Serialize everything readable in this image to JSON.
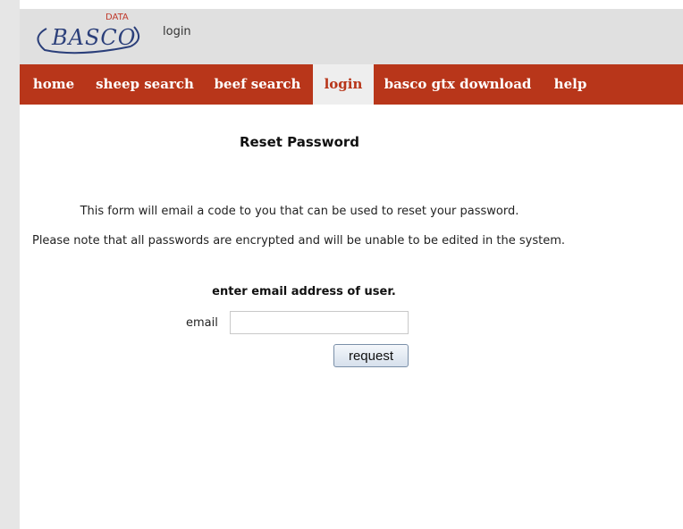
{
  "header": {
    "logo_text": "BASCO",
    "logo_superscript": "DATA",
    "login_link": "login"
  },
  "nav": {
    "items": [
      {
        "label": "home",
        "active": false
      },
      {
        "label": "sheep search",
        "active": false
      },
      {
        "label": "beef search",
        "active": false
      },
      {
        "label": "login",
        "active": true
      },
      {
        "label": "basco gtx download",
        "active": false
      },
      {
        "label": "help",
        "active": false
      }
    ]
  },
  "main": {
    "title": "Reset Password",
    "description_1": "This form will email a code to you that can be used to reset your password.",
    "description_2": "Please note that all passwords are encrypted and will be unable to be edited in the system.",
    "form_heading": "enter email address of user.",
    "email_label": "email",
    "email_value": "",
    "request_label": "request"
  },
  "colors": {
    "nav_background": "#b8361a",
    "logo_blue": "#2b3f7a",
    "logo_red": "#c0392b"
  }
}
